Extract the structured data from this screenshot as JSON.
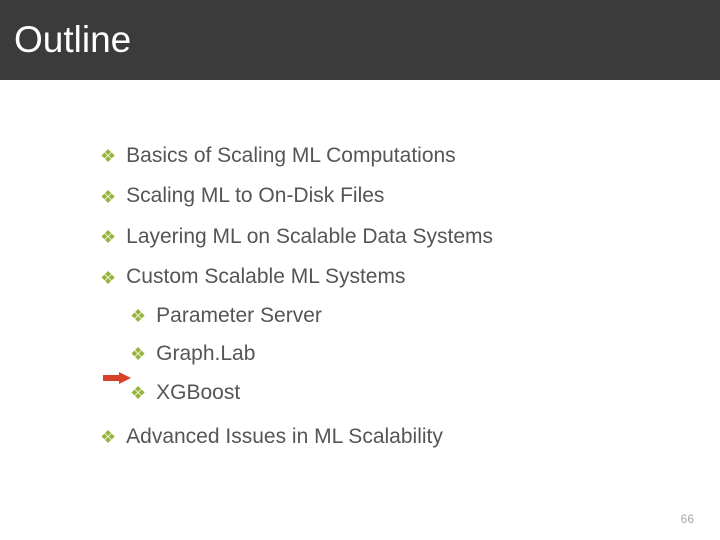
{
  "header": {
    "title": "Outline"
  },
  "bullets": {
    "glyph": "❖"
  },
  "outline": {
    "items": [
      {
        "text": "Basics of Scaling ML Computations"
      },
      {
        "text": "Scaling ML to On-Disk Files"
      },
      {
        "text": "Layering ML on Scalable Data Systems"
      },
      {
        "text": "Custom Scalable ML Systems",
        "sub": [
          {
            "text": "Parameter Server"
          },
          {
            "text": "Graph.Lab"
          },
          {
            "text": "XGBoost"
          }
        ]
      },
      {
        "text": "Advanced Issues in ML Scalability"
      }
    ]
  },
  "arrow": {
    "color": "#d84028"
  },
  "page": {
    "number": "66"
  }
}
